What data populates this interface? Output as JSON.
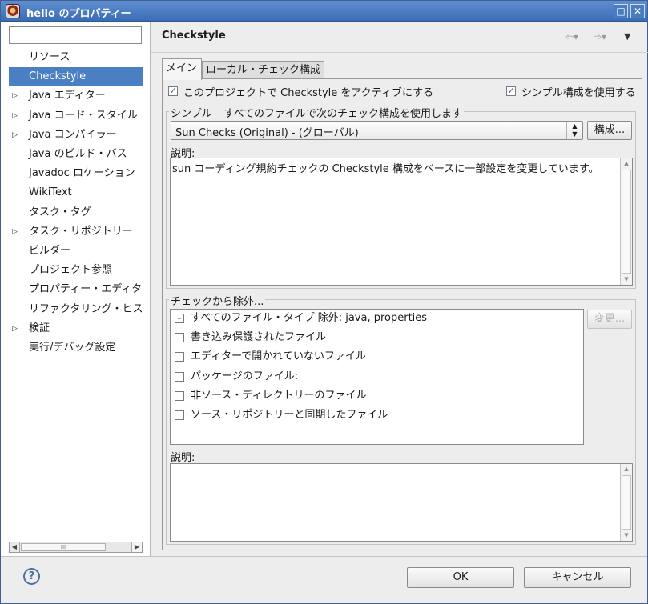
{
  "window": {
    "title": "hello のプロパティー",
    "maximize_glyph": "□",
    "close_glyph": "✕"
  },
  "sidebar": {
    "filter_value": "",
    "items": [
      {
        "label": "リソース",
        "expandable": false,
        "selected": false
      },
      {
        "label": "Checkstyle",
        "expandable": false,
        "selected": true
      },
      {
        "label": "Java エディター",
        "expandable": true,
        "selected": false
      },
      {
        "label": "Java コード・スタイル",
        "expandable": true,
        "selected": false
      },
      {
        "label": "Java コンパイラー",
        "expandable": true,
        "selected": false
      },
      {
        "label": "Java のビルド・パス",
        "expandable": false,
        "selected": false
      },
      {
        "label": "Javadoc ロケーション",
        "expandable": false,
        "selected": false
      },
      {
        "label": "WikiText",
        "expandable": false,
        "selected": false
      },
      {
        "label": "タスク・タグ",
        "expandable": false,
        "selected": false
      },
      {
        "label": "タスク・リポジトリー",
        "expandable": true,
        "selected": false
      },
      {
        "label": "ビルダー",
        "expandable": false,
        "selected": false
      },
      {
        "label": "プロジェクト参照",
        "expandable": false,
        "selected": false
      },
      {
        "label": "プロパティー・エディタ",
        "expandable": false,
        "selected": false
      },
      {
        "label": "リファクタリング・ヒス",
        "expandable": false,
        "selected": false
      },
      {
        "label": "検証",
        "expandable": true,
        "selected": false
      },
      {
        "label": "実行/デバッグ設定",
        "expandable": false,
        "selected": false
      }
    ]
  },
  "page": {
    "title": "Checkstyle",
    "back_glyph": "⇦▾",
    "forward_glyph": "⇨▾",
    "menu_glyph": "▼"
  },
  "tabs": {
    "main": "メイン",
    "local": "ローカル・チェック構成"
  },
  "main_tab": {
    "activate_label": "このプロジェクトで  Checkstyle をアクティブにする",
    "activate_checked": true,
    "simple_config_label": "シンプル構成を使用する",
    "simple_config_checked": true,
    "simple_group_title": "シンプル  –  すべてのファイルで次のチェック構成を使用します",
    "config_selected": "Sun Checks (Original)  - (グローバル)",
    "configure_button": "構成...",
    "description_label": "説明:",
    "description_text": "sun コーディング規約チェックの  Checkstyle 構成をベースに一部設定を変更しています。",
    "exclude_group_title": "チェックから除外...",
    "change_button": "変更...",
    "exclude_items": [
      {
        "label": "すべてのファイル・タイプ  除外:  java, properties",
        "state": "partial"
      },
      {
        "label": "書き込み保護されたファイル",
        "state": "unchecked"
      },
      {
        "label": "エディターで開かれていないファイル",
        "state": "unchecked"
      },
      {
        "label": "パッケージのファイル:",
        "state": "unchecked"
      },
      {
        "label": "非ソース・ディレクトリーのファイル",
        "state": "unchecked"
      },
      {
        "label": "ソース・リポジトリーと同期したファイル",
        "state": "unchecked"
      }
    ],
    "filter_description_label": "説明:",
    "filter_description_text": ""
  },
  "footer": {
    "help_glyph": "?",
    "ok": "OK",
    "cancel": "キャンセル"
  },
  "colors": {
    "selection": "#4a7fc4",
    "titlebar": "#3a6db5"
  }
}
